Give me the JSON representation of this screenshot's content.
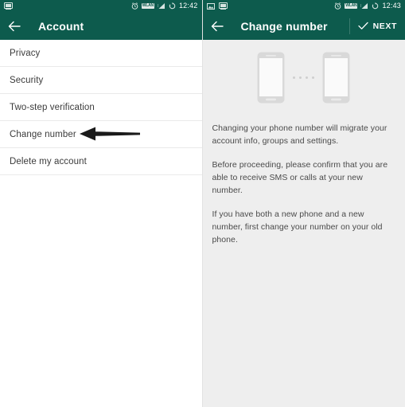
{
  "theme": {
    "header_bg": "#0d5b4d",
    "panel_left_bg": "#ffffff",
    "panel_right_bg": "#eeeeee",
    "text_primary": "#3b3b3b",
    "text_body": "#4a4a4a",
    "divider": "#eaeaea",
    "illustration_grey": "#d7d7d7",
    "arrow_color": "#1a1a1a"
  },
  "left_panel": {
    "statusbar": {
      "icons_left": [
        "cast-screen-icon"
      ],
      "icons_right": [
        "alarm-clock-icon",
        "wifi-badge-icon",
        "signal-bars-icon",
        "rotation-lock-icon"
      ],
      "wifi_label": "WLAN",
      "time": "12:42"
    },
    "appbar": {
      "back_icon": "back-arrow-icon",
      "title": "Account"
    },
    "list": [
      {
        "label": "Privacy"
      },
      {
        "label": "Security"
      },
      {
        "label": "Two-step verification"
      },
      {
        "label": "Change number"
      },
      {
        "label": "Delete my account"
      }
    ],
    "annotation": {
      "type": "arrow-pointing-left",
      "target": "Change number"
    }
  },
  "right_panel": {
    "statusbar": {
      "icons_left": [
        "image-icon",
        "cast-screen-icon"
      ],
      "icons_right": [
        "alarm-clock-icon",
        "wifi-badge-icon",
        "signal-bars-icon",
        "rotation-lock-icon"
      ],
      "wifi_label": "WLAN",
      "time": "12:43"
    },
    "appbar": {
      "back_icon": "back-arrow-icon",
      "title": "Change number",
      "action_icon": "check-icon",
      "action_label": "NEXT"
    },
    "illustration": {
      "left_phone": "phone-outline-icon",
      "right_phone": "phone-outline-icon",
      "dot_count": 4
    },
    "paragraphs": [
      "Changing your phone number will migrate your account info, groups and settings.",
      "Before proceeding, please confirm that you are able to receive SMS or calls at your new number.",
      "If you have both a new phone and a new number, first change your number on your old phone."
    ]
  }
}
